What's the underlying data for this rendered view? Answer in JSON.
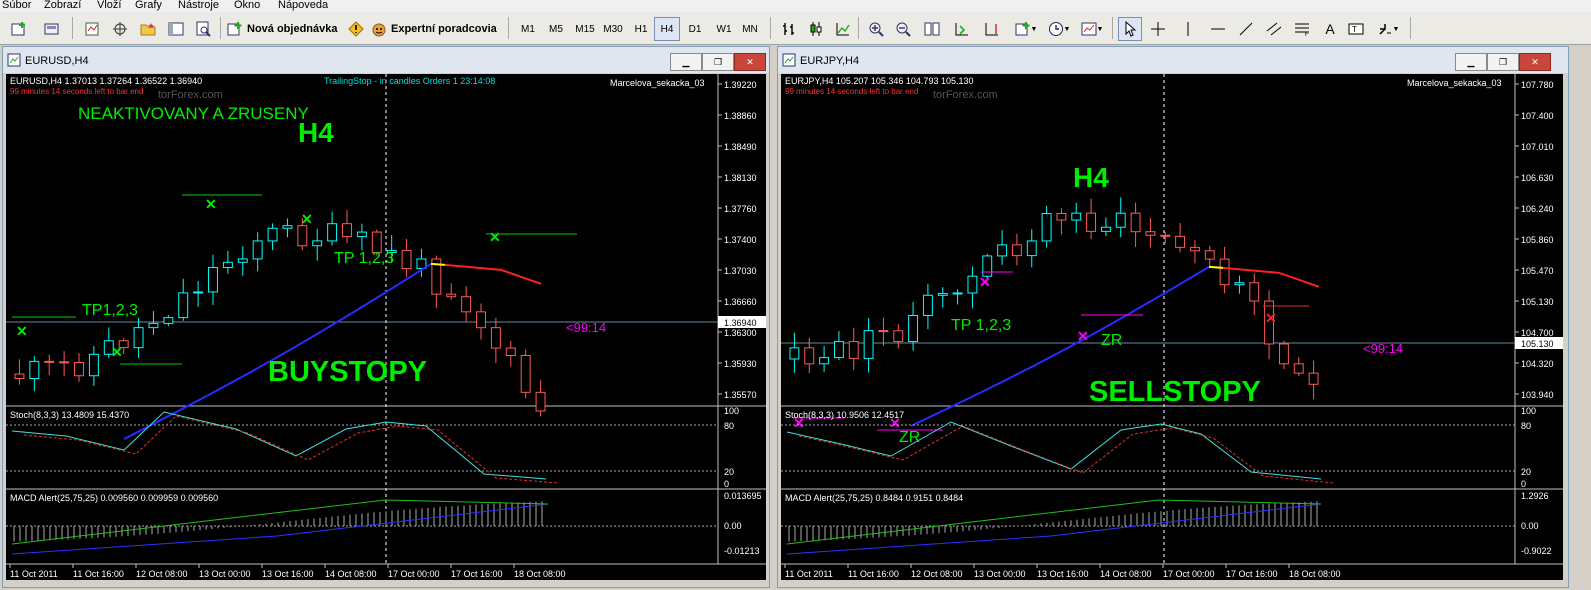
{
  "menu": [
    "Súbor",
    "Zobrazí",
    "Vloží",
    "Grafy",
    "Nástroje",
    "Okno",
    "Nápoveda"
  ],
  "toolbar": {
    "new_order": "Nová objednávka",
    "expert_advisors": "Expertní poradcovia",
    "timeframes": [
      "M1",
      "M5",
      "M15",
      "M30",
      "H1",
      "H4",
      "D1",
      "W1",
      "MN"
    ],
    "active_timeframe": "H4"
  },
  "left_window": {
    "title": "EURUSD,H4",
    "info": "EURUSD,H4  1.37013 1.37264 1.36522 1.36940",
    "countdown_overlay": "99 minutes 14 seconds left to bar end",
    "watermark": "torForex.com",
    "trailing": "TrailingStop - in candles  Orders 1  23:14:08",
    "indicator_name": "Marcelova_sekacka_03",
    "note_neaktivovany": "NEAKTIVOVANY A ZRUSENY",
    "note_h4": "H4",
    "note_tp": "TP1,2,3",
    "note_tp2": "TP 1,2,3",
    "note_main": "BUYSTOPY",
    "countdown": "<99:14",
    "price_axis": [
      "1.39220",
      "1.38860",
      "1.38490",
      "1.38130",
      "1.37760",
      "1.37400",
      "1.37030",
      "1.36660",
      "1.36300",
      "1.35930",
      "1.35570"
    ],
    "current_price": "1.36940",
    "stoch_label": "Stoch(8,3,3) 13.4809 15.4370",
    "stoch_axis": [
      "100",
      "80",
      "20",
      "0"
    ],
    "macd_label": "MACD Alert(25,75,25) 0.009560 0.009959 0.009560",
    "macd_axis": [
      "0.013695",
      "0.00",
      "-0.01213"
    ],
    "time_axis": [
      "11 Oct 2011",
      "11 Oct 16:00",
      "12 Oct 08:00",
      "13 Oct 00:00",
      "13 Oct 16:00",
      "14 Oct 08:00",
      "17 Oct 00:00",
      "17 Oct 16:00",
      "18 Oct 08:00"
    ]
  },
  "right_window": {
    "title": "EURJPY,H4",
    "info": "EURJPY,H4  105.207 105.346 104.793 105.130",
    "countdown_overlay": "99 minutes 14 seconds left to bar end",
    "watermark": "torForex.com",
    "indicator_name": "Marcelova_sekacka_03",
    "note_h4": "H4",
    "note_tp": "TP 1,2,3",
    "note_zr1": "ZR",
    "note_zr2": "ZR",
    "note_main": "SELLSTOPY",
    "countdown": "<99:14",
    "price_axis": [
      "107.780",
      "107.400",
      "107.010",
      "106.630",
      "106.240",
      "105.860",
      "105.470",
      "105.130",
      "104.700",
      "104.320",
      "103.940"
    ],
    "current_price": "105.130",
    "stoch_label": "Stoch(8,3,3) 10.9506 12.4517",
    "stoch_axis": [
      "100",
      "80",
      "20",
      "0"
    ],
    "macd_label": "MACD Alert(25,75,25) 0.8484 0.9151 0.8484",
    "macd_axis": [
      "1.2926",
      "0.00",
      "-0.9022"
    ],
    "time_axis": [
      "11 Oct 2011",
      "11 Oct 16:00",
      "12 Oct 08:00",
      "13 Oct 00:00",
      "13 Oct 16:00",
      "14 Oct 08:00",
      "17 Oct 00:00",
      "17 Oct 16:00",
      "18 Oct 08:00"
    ]
  },
  "colors": {
    "bull": "#00ffff",
    "bear": "#ff5a5a",
    "green_text": "#00ee00",
    "magenta": "#ff00ff",
    "ma_blue": "#2a2aff",
    "ma_red": "#ff2020"
  }
}
